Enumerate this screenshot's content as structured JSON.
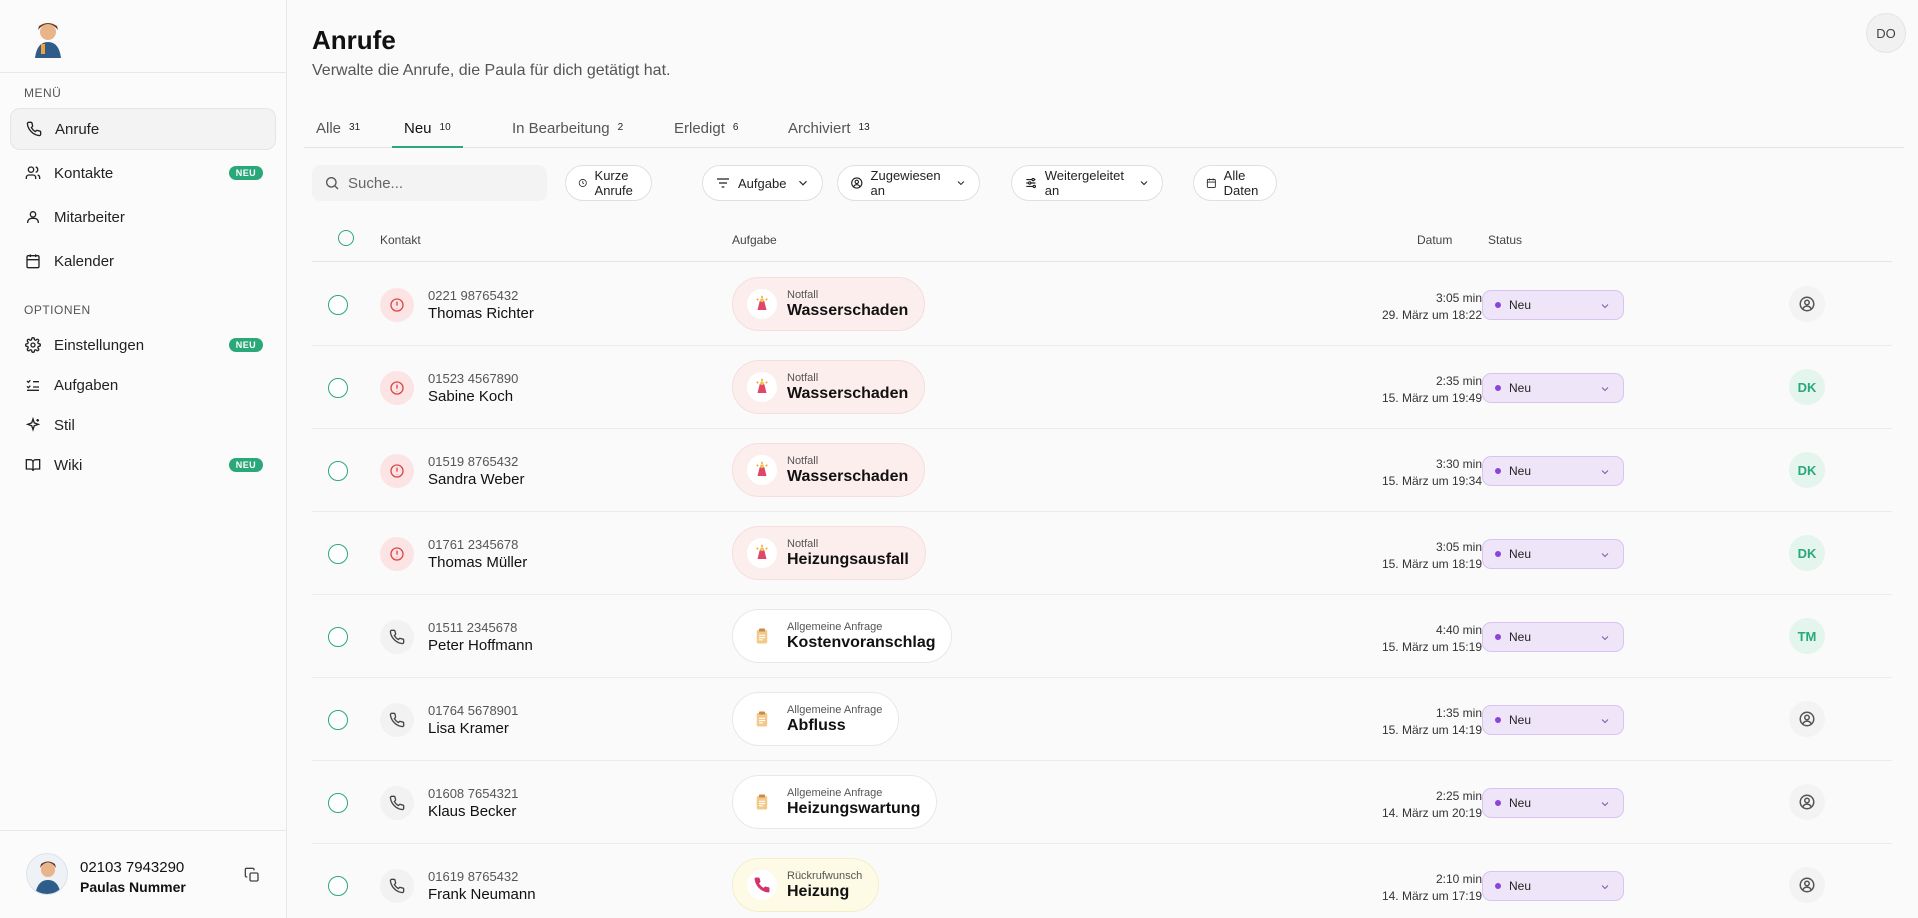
{
  "sidebar": {
    "menu_label": "MENÜ",
    "options_label": "OPTIONEN",
    "menu_items": [
      {
        "label": "Anrufe",
        "icon": "phone-icon",
        "active": true
      },
      {
        "label": "Kontakte",
        "icon": "contacts-icon",
        "badge": "NEU"
      },
      {
        "label": "Mitarbeiter",
        "icon": "user-icon"
      },
      {
        "label": "Kalender",
        "icon": "calendar-icon"
      }
    ],
    "option_items": [
      {
        "label": "Einstellungen",
        "icon": "gear-icon",
        "badge": "NEU"
      },
      {
        "label": "Aufgaben",
        "icon": "tasks-icon"
      },
      {
        "label": "Stil",
        "icon": "sparkle-icon"
      },
      {
        "label": "Wiki",
        "icon": "book-icon",
        "badge": "NEU"
      }
    ],
    "footer": {
      "phone": "02103 7943290",
      "name": "Paulas Nummer"
    }
  },
  "header": {
    "title": "Anrufe",
    "subtitle": "Verwalte die Anrufe, die Paula für dich getätigt hat.",
    "user_initials": "DO"
  },
  "tabs": [
    {
      "label": "Alle",
      "count": "31"
    },
    {
      "label": "Neu",
      "count": "10",
      "active": true
    },
    {
      "label": "In Bearbeitung",
      "count": "2"
    },
    {
      "label": "Erledigt",
      "count": "6"
    },
    {
      "label": "Archiviert",
      "count": "13"
    }
  ],
  "toolbar": {
    "search_placeholder": "Suche...",
    "filters": [
      "Kurze Anrufe",
      "Aufgabe",
      "Zugewiesen an",
      "Weitergeleitet an",
      "Alle Daten"
    ]
  },
  "table": {
    "headers": {
      "contact": "Kontakt",
      "task": "Aufgabe",
      "date": "Datum",
      "status": "Status"
    },
    "rows": [
      {
        "kind": "alert",
        "phone": "0221 98765432",
        "name": "Thomas Richter",
        "task_type": "emergency",
        "task_category": "Notfall",
        "task_title": "Wasserschaden",
        "duration": "3:05 min",
        "date": "29. März um 18:22",
        "status": "Neu",
        "assignee": ""
      },
      {
        "kind": "alert",
        "phone": "01523 4567890",
        "name": "Sabine Koch",
        "task_type": "emergency",
        "task_category": "Notfall",
        "task_title": "Wasserschaden",
        "duration": "2:35 min",
        "date": "15. März um 19:49",
        "status": "Neu",
        "assignee": "DK"
      },
      {
        "kind": "alert",
        "phone": "01519 8765432",
        "name": "Sandra Weber",
        "task_type": "emergency",
        "task_category": "Notfall",
        "task_title": "Wasserschaden",
        "duration": "3:30 min",
        "date": "15. März um 19:34",
        "status": "Neu",
        "assignee": "DK"
      },
      {
        "kind": "alert",
        "phone": "01761 2345678",
        "name": "Thomas Müller",
        "task_type": "emergency",
        "task_category": "Notfall",
        "task_title": "Heizungsausfall",
        "duration": "3:05 min",
        "date": "15. März um 18:19",
        "status": "Neu",
        "assignee": "DK"
      },
      {
        "kind": "phone",
        "phone": "01511 2345678",
        "name": "Peter Hoffmann",
        "task_type": "general",
        "task_category": "Allgemeine Anfrage",
        "task_title": "Kostenvoranschlag",
        "duration": "4:40 min",
        "date": "15. März um 15:19",
        "status": "Neu",
        "assignee": "TM"
      },
      {
        "kind": "phone",
        "phone": "01764 5678901",
        "name": "Lisa Kramer",
        "task_type": "general",
        "task_category": "Allgemeine Anfrage",
        "task_title": "Abfluss",
        "duration": "1:35 min",
        "date": "15. März um 14:19",
        "status": "Neu",
        "assignee": ""
      },
      {
        "kind": "phone",
        "phone": "01608 7654321",
        "name": "Klaus Becker",
        "task_type": "general",
        "task_category": "Allgemeine Anfrage",
        "task_title": "Heizungswartung",
        "duration": "2:25 min",
        "date": "14. März um 20:19",
        "status": "Neu",
        "assignee": ""
      },
      {
        "kind": "phone",
        "phone": "01619 8765432",
        "name": "Frank Neumann",
        "task_type": "callback",
        "task_category": "Rückrufwunsch",
        "task_title": "Heizung",
        "duration": "2:10 min",
        "date": "14. März um 17:19",
        "status": "Neu",
        "assignee": ""
      }
    ]
  },
  "colors": {
    "accent": "#2aa87a",
    "status_dot": "#8b44d8",
    "alert": "#d94848"
  }
}
